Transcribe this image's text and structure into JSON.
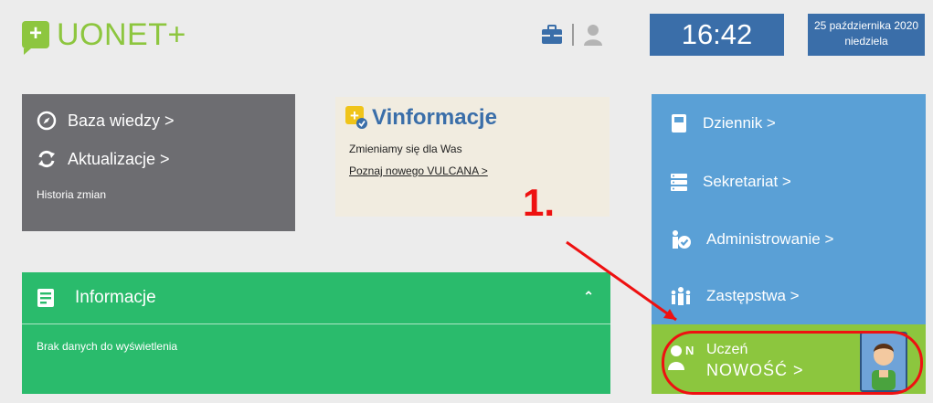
{
  "app": {
    "title": "UONET+"
  },
  "header": {
    "time": "16:42",
    "date_line1": "25 października 2020",
    "date_line2": "niedziela",
    "icons": [
      "briefcase-icon",
      "user-icon"
    ]
  },
  "knowledge_tile": {
    "items": [
      {
        "label": "Baza wiedzy >",
        "icon": "compass-icon"
      },
      {
        "label": "Aktualizacje >",
        "icon": "refresh-icon"
      }
    ],
    "history": "Historia zmian"
  },
  "vinfo": {
    "title": "Vinformacje",
    "subtitle": "Zmieniamy się dla Was",
    "link": "Poznaj nowego VULCANA >"
  },
  "info_tile": {
    "title": "Informacje",
    "empty_text": "Brak danych do wyświetlenia"
  },
  "modules": [
    {
      "label": "Dziennik >",
      "icon": "journal-icon"
    },
    {
      "label": "Sekretariat >",
      "icon": "server-icon"
    },
    {
      "label": "Administrowanie >",
      "icon": "admin-check-icon"
    },
    {
      "label": "Zastępstwa >",
      "icon": "group-icon"
    }
  ],
  "student_tile": {
    "label": "Uczeń",
    "sub": "NOWOŚĆ >",
    "badge": "N",
    "icon": "student-icon"
  },
  "annotation": {
    "number": "1."
  },
  "colors": {
    "brand_green": "#8dc63f",
    "header_blue": "#3a6ea9",
    "tile_gray": "#6d6d71",
    "tile_green": "#2abb6c",
    "tile_blue": "#5aa0d6",
    "tile_lime": "#8cc63e",
    "annotation_red": "#e11111"
  }
}
